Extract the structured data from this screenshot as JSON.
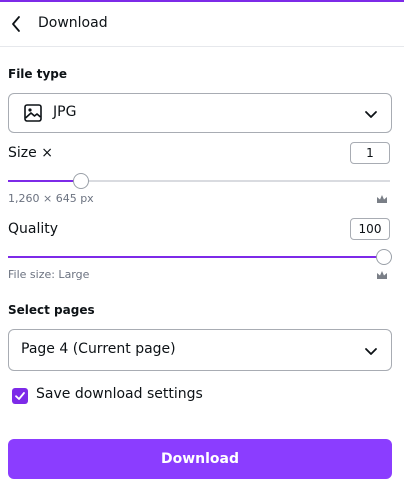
{
  "header": {
    "title": "Download"
  },
  "file_type": {
    "label": "File type",
    "value": "JPG",
    "icon": "image-icon"
  },
  "size": {
    "label": "Size ×",
    "value": "1",
    "dimensions": "1,260 × 645 px",
    "slider_fraction": 0.19
  },
  "quality": {
    "label": "Quality",
    "value": "100",
    "file_size": "File size: Large",
    "slider_fraction": 1.0
  },
  "pages": {
    "label": "Select pages",
    "value": "Page 4 (Current page)"
  },
  "save_settings": {
    "label": "Save download settings",
    "checked": true
  },
  "download_button": {
    "label": "Download"
  },
  "colors": {
    "accent": "#7d2ae8",
    "button": "#8b3dff"
  }
}
